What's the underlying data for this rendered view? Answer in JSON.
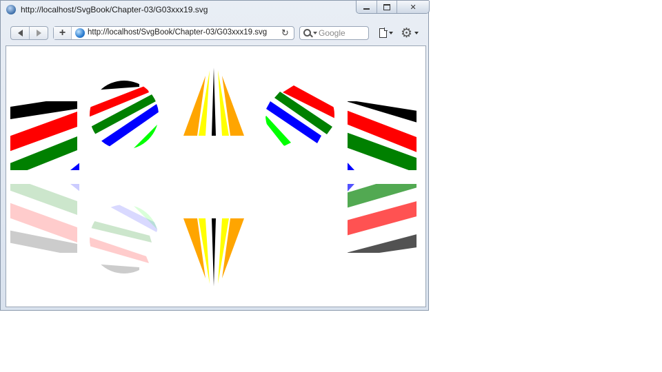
{
  "window": {
    "title": "http://localhost/SvgBook/Chapter-03/G03xxx19.svg"
  },
  "toolbar": {
    "url": "http://localhost/SvgBook/Chapter-03/G03xxx19.svg",
    "search_placeholder": "Google"
  },
  "icons": {
    "title": "browser-globe-icon",
    "back": "back-arrow-icon",
    "forward": "forward-arrow-icon",
    "add": "plus-icon",
    "site": "globe-icon",
    "reload": "reload-icon",
    "search": "search-icon",
    "page": "page-icon",
    "tools": "gear-icon"
  },
  "palette": {
    "stripe_colors": [
      "#000000",
      "#ff0000",
      "#008000",
      "#0000ff",
      "#00ff00"
    ],
    "fan_colors": [
      "#ffa500",
      "#ffff00",
      "#000000"
    ]
  }
}
